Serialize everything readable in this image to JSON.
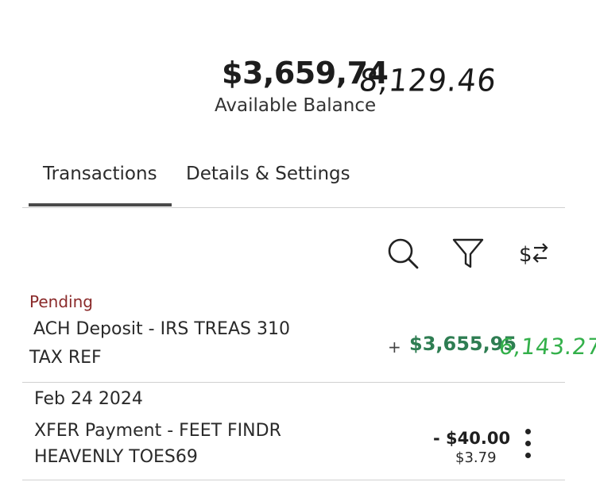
{
  "balance": {
    "amount": "$3,659,74",
    "handwritten": "8,129.46",
    "label": "Available Balance"
  },
  "tabs": [
    {
      "label": "Transactions",
      "active": true
    },
    {
      "label": "Details & Settings",
      "active": false
    }
  ],
  "toolbar": {
    "icons": [
      "search-icon",
      "filter-icon",
      "sort-amount-icon"
    ]
  },
  "transactions": [
    {
      "status": "Pending",
      "description_line1": "ACH Deposit - IRS TREAS 310",
      "description_line2": "TAX REF",
      "sign": "+",
      "amount": "$3,655,95",
      "handwritten_amount": "6,143.27"
    },
    {
      "date": "Feb 24 2024",
      "description_line1": "XFER Payment  -  FEET FINDR",
      "description_line2": "HEAVENLY TOES69",
      "amount": "- $40.00",
      "sub_amount": "$3.79"
    }
  ],
  "colors": {
    "pending": "#8a2a2a",
    "deposit_green": "#2e7d52",
    "handwritten_green": "#33b04a",
    "tab_underline": "#4a4a4a"
  }
}
